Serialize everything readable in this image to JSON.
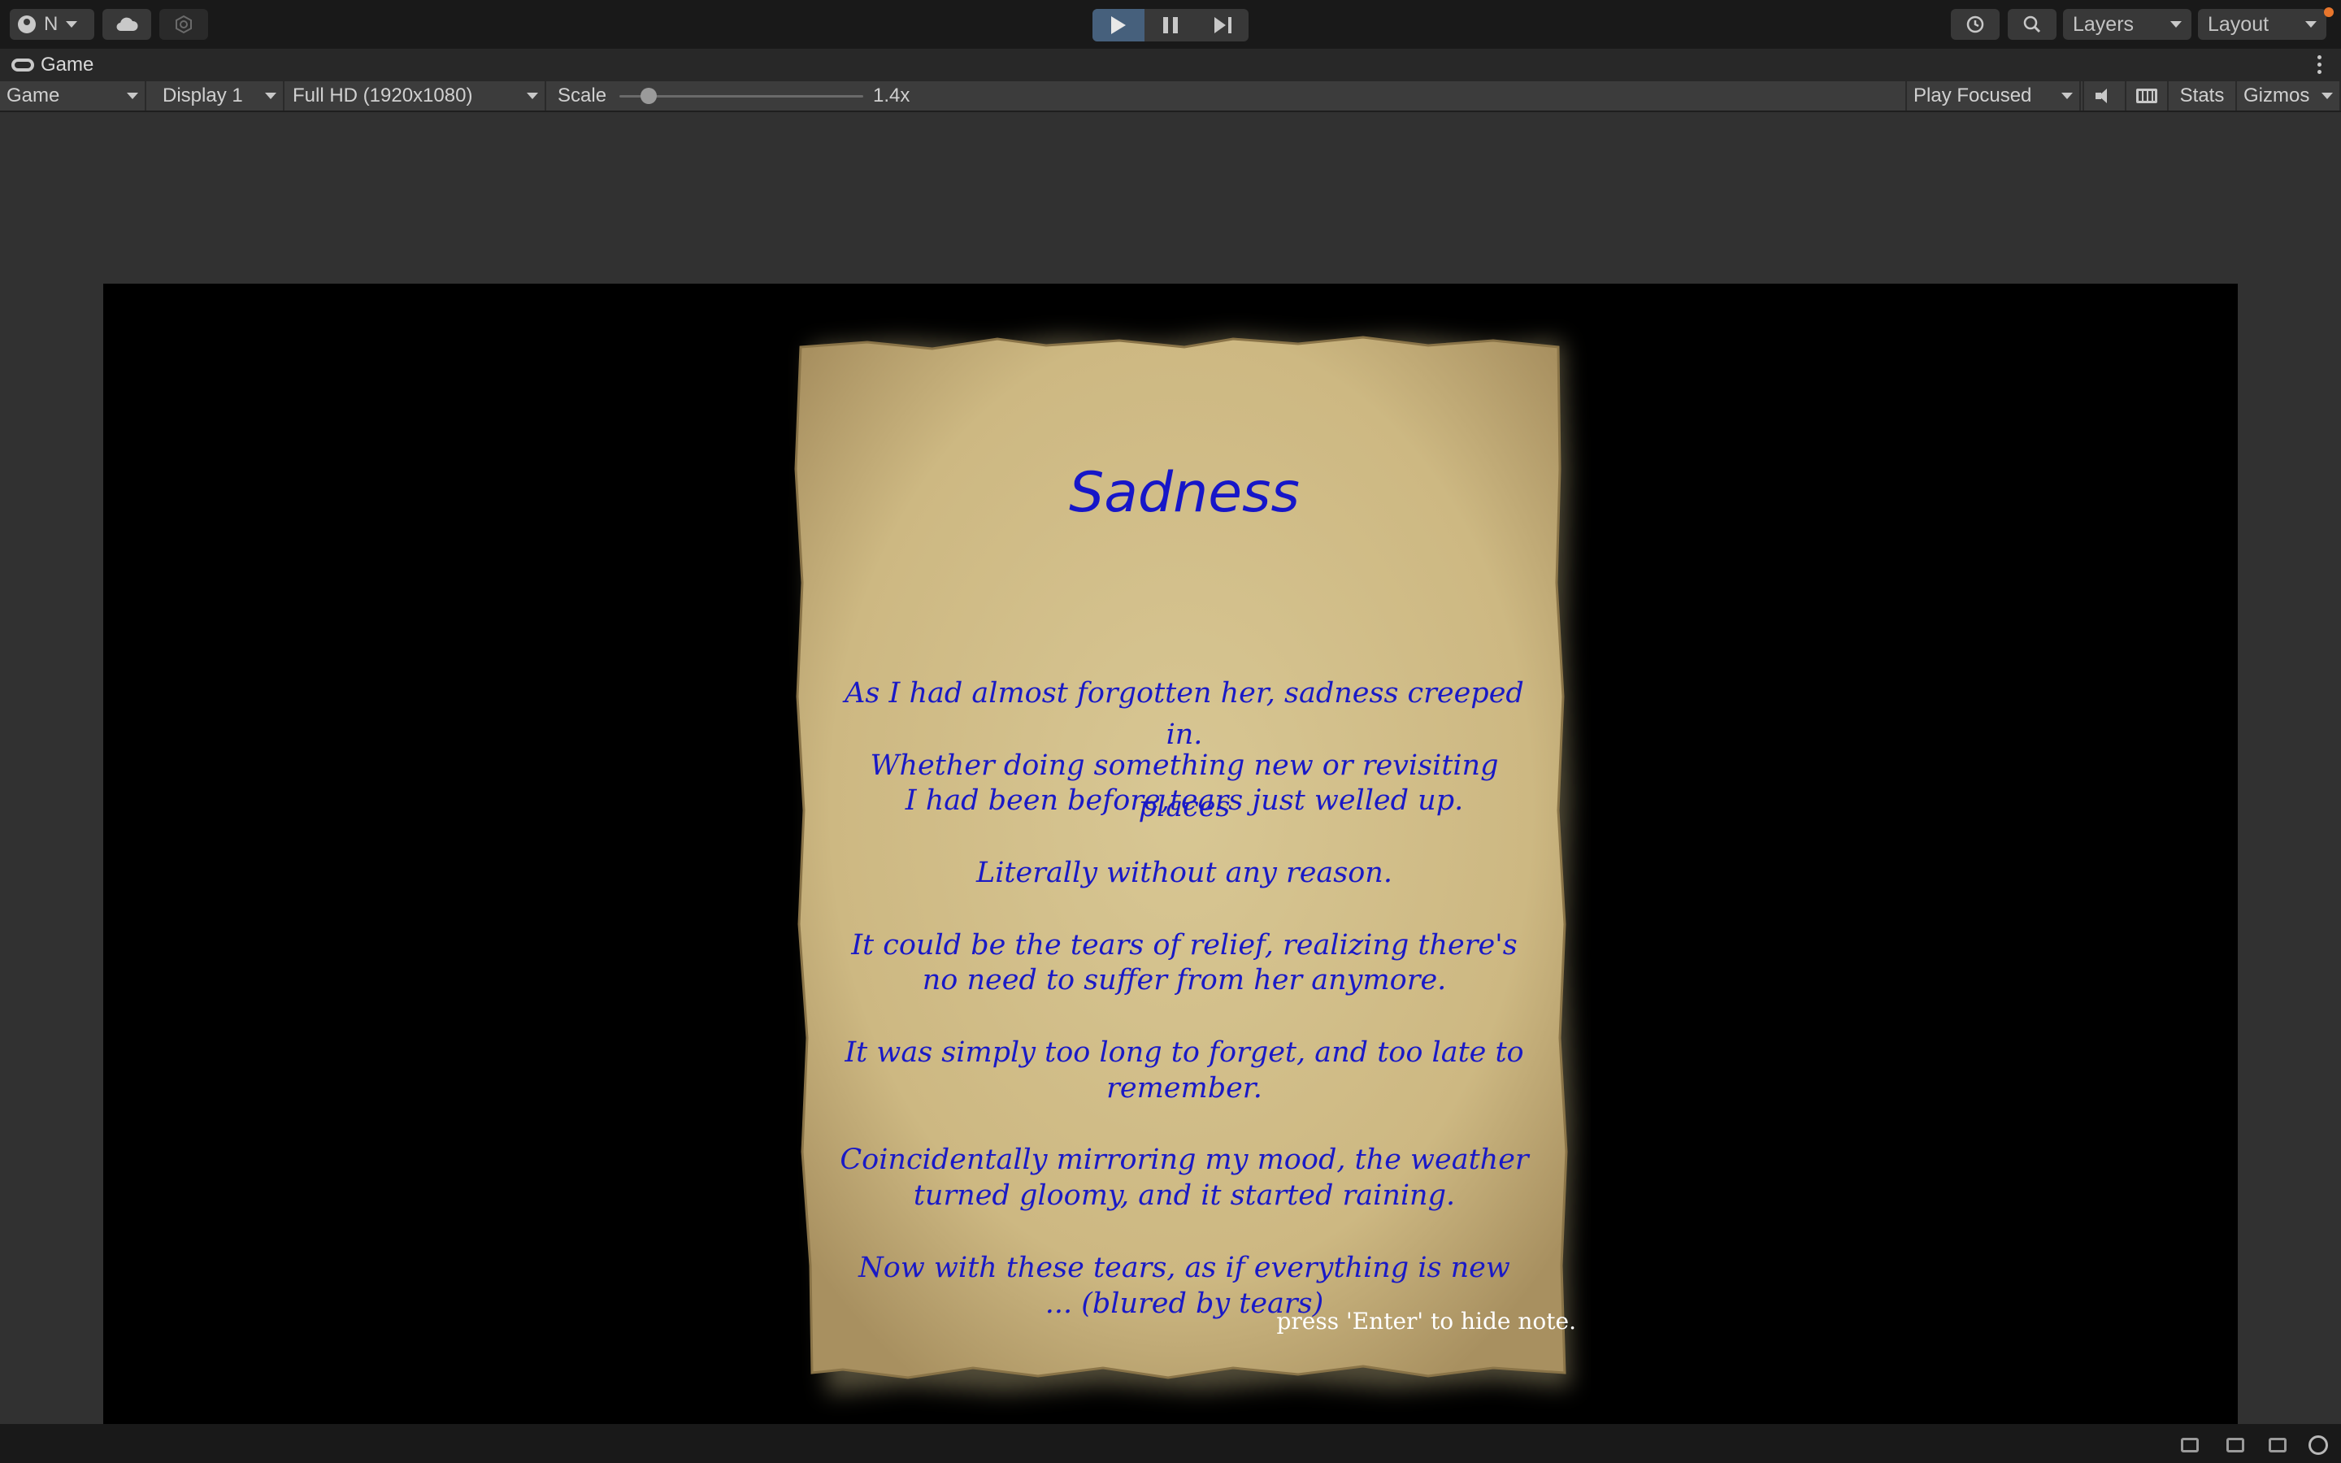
{
  "toolbar": {
    "account_initial": "N",
    "layers_label": "Layers",
    "layout_label": "Layout"
  },
  "tab": {
    "title": "Game"
  },
  "controls": {
    "mode": "Game",
    "display": "Display 1",
    "resolution": "Full HD (1920x1080)",
    "scale_label": "Scale",
    "scale_value": "1.4x",
    "scale_fraction": 0.12,
    "play_mode": "Play Focused",
    "stats": "Stats",
    "gizmos": "Gizmos"
  },
  "note": {
    "title": "Sadness",
    "paragraphs": [
      [
        "As I had almost forgotten her, sadness creeped in."
      ],
      [
        "Whether doing something new or revisiting places",
        "I had been before,tears just welled up."
      ],
      [
        "Literally without any reason."
      ],
      [
        "It could be the tears of relief, realizing there's",
        "no need to suffer from her anymore."
      ],
      [
        "It was simply too long to forget, and too late to",
        "remember."
      ],
      [
        "Coincidentally mirroring my mood, the weather",
        "turned gloomy, and it started raining."
      ],
      [
        "Now with these tears, as if everything is new",
        "... (blured by tears)"
      ]
    ],
    "hint": "press 'Enter' to hide note."
  },
  "colors": {
    "note_ink": "#1919c6",
    "paper": "#d4c08c",
    "play_active": "#46607c"
  }
}
